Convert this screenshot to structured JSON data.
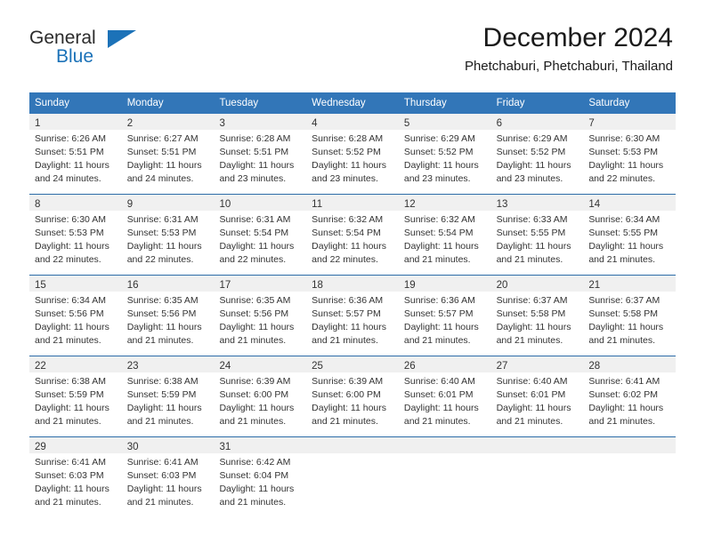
{
  "brand": {
    "name_part1": "General",
    "name_part2": "Blue",
    "triangle_color": "#1c72b8"
  },
  "header": {
    "title": "December 2024",
    "subtitle": "Phetchaburi, Phetchaburi, Thailand"
  },
  "colors": {
    "header_blue": "#3276b8",
    "row_separator": "#2c6ca8",
    "daynum_band": "#f0f0f0",
    "text": "#333333",
    "brand_blue": "#1c72b8"
  },
  "calendar": {
    "weekdays": [
      "Sunday",
      "Monday",
      "Tuesday",
      "Wednesday",
      "Thursday",
      "Friday",
      "Saturday"
    ],
    "weeks": [
      [
        {
          "day": "1",
          "sunrise": "Sunrise: 6:26 AM",
          "sunset": "Sunset: 5:51 PM",
          "daylight1": "Daylight: 11 hours",
          "daylight2": "and 24 minutes."
        },
        {
          "day": "2",
          "sunrise": "Sunrise: 6:27 AM",
          "sunset": "Sunset: 5:51 PM",
          "daylight1": "Daylight: 11 hours",
          "daylight2": "and 24 minutes."
        },
        {
          "day": "3",
          "sunrise": "Sunrise: 6:28 AM",
          "sunset": "Sunset: 5:51 PM",
          "daylight1": "Daylight: 11 hours",
          "daylight2": "and 23 minutes."
        },
        {
          "day": "4",
          "sunrise": "Sunrise: 6:28 AM",
          "sunset": "Sunset: 5:52 PM",
          "daylight1": "Daylight: 11 hours",
          "daylight2": "and 23 minutes."
        },
        {
          "day": "5",
          "sunrise": "Sunrise: 6:29 AM",
          "sunset": "Sunset: 5:52 PM",
          "daylight1": "Daylight: 11 hours",
          "daylight2": "and 23 minutes."
        },
        {
          "day": "6",
          "sunrise": "Sunrise: 6:29 AM",
          "sunset": "Sunset: 5:52 PM",
          "daylight1": "Daylight: 11 hours",
          "daylight2": "and 23 minutes."
        },
        {
          "day": "7",
          "sunrise": "Sunrise: 6:30 AM",
          "sunset": "Sunset: 5:53 PM",
          "daylight1": "Daylight: 11 hours",
          "daylight2": "and 22 minutes."
        }
      ],
      [
        {
          "day": "8",
          "sunrise": "Sunrise: 6:30 AM",
          "sunset": "Sunset: 5:53 PM",
          "daylight1": "Daylight: 11 hours",
          "daylight2": "and 22 minutes."
        },
        {
          "day": "9",
          "sunrise": "Sunrise: 6:31 AM",
          "sunset": "Sunset: 5:53 PM",
          "daylight1": "Daylight: 11 hours",
          "daylight2": "and 22 minutes."
        },
        {
          "day": "10",
          "sunrise": "Sunrise: 6:31 AM",
          "sunset": "Sunset: 5:54 PM",
          "daylight1": "Daylight: 11 hours",
          "daylight2": "and 22 minutes."
        },
        {
          "day": "11",
          "sunrise": "Sunrise: 6:32 AM",
          "sunset": "Sunset: 5:54 PM",
          "daylight1": "Daylight: 11 hours",
          "daylight2": "and 22 minutes."
        },
        {
          "day": "12",
          "sunrise": "Sunrise: 6:32 AM",
          "sunset": "Sunset: 5:54 PM",
          "daylight1": "Daylight: 11 hours",
          "daylight2": "and 21 minutes."
        },
        {
          "day": "13",
          "sunrise": "Sunrise: 6:33 AM",
          "sunset": "Sunset: 5:55 PM",
          "daylight1": "Daylight: 11 hours",
          "daylight2": "and 21 minutes."
        },
        {
          "day": "14",
          "sunrise": "Sunrise: 6:34 AM",
          "sunset": "Sunset: 5:55 PM",
          "daylight1": "Daylight: 11 hours",
          "daylight2": "and 21 minutes."
        }
      ],
      [
        {
          "day": "15",
          "sunrise": "Sunrise: 6:34 AM",
          "sunset": "Sunset: 5:56 PM",
          "daylight1": "Daylight: 11 hours",
          "daylight2": "and 21 minutes."
        },
        {
          "day": "16",
          "sunrise": "Sunrise: 6:35 AM",
          "sunset": "Sunset: 5:56 PM",
          "daylight1": "Daylight: 11 hours",
          "daylight2": "and 21 minutes."
        },
        {
          "day": "17",
          "sunrise": "Sunrise: 6:35 AM",
          "sunset": "Sunset: 5:56 PM",
          "daylight1": "Daylight: 11 hours",
          "daylight2": "and 21 minutes."
        },
        {
          "day": "18",
          "sunrise": "Sunrise: 6:36 AM",
          "sunset": "Sunset: 5:57 PM",
          "daylight1": "Daylight: 11 hours",
          "daylight2": "and 21 minutes."
        },
        {
          "day": "19",
          "sunrise": "Sunrise: 6:36 AM",
          "sunset": "Sunset: 5:57 PM",
          "daylight1": "Daylight: 11 hours",
          "daylight2": "and 21 minutes."
        },
        {
          "day": "20",
          "sunrise": "Sunrise: 6:37 AM",
          "sunset": "Sunset: 5:58 PM",
          "daylight1": "Daylight: 11 hours",
          "daylight2": "and 21 minutes."
        },
        {
          "day": "21",
          "sunrise": "Sunrise: 6:37 AM",
          "sunset": "Sunset: 5:58 PM",
          "daylight1": "Daylight: 11 hours",
          "daylight2": "and 21 minutes."
        }
      ],
      [
        {
          "day": "22",
          "sunrise": "Sunrise: 6:38 AM",
          "sunset": "Sunset: 5:59 PM",
          "daylight1": "Daylight: 11 hours",
          "daylight2": "and 21 minutes."
        },
        {
          "day": "23",
          "sunrise": "Sunrise: 6:38 AM",
          "sunset": "Sunset: 5:59 PM",
          "daylight1": "Daylight: 11 hours",
          "daylight2": "and 21 minutes."
        },
        {
          "day": "24",
          "sunrise": "Sunrise: 6:39 AM",
          "sunset": "Sunset: 6:00 PM",
          "daylight1": "Daylight: 11 hours",
          "daylight2": "and 21 minutes."
        },
        {
          "day": "25",
          "sunrise": "Sunrise: 6:39 AM",
          "sunset": "Sunset: 6:00 PM",
          "daylight1": "Daylight: 11 hours",
          "daylight2": "and 21 minutes."
        },
        {
          "day": "26",
          "sunrise": "Sunrise: 6:40 AM",
          "sunset": "Sunset: 6:01 PM",
          "daylight1": "Daylight: 11 hours",
          "daylight2": "and 21 minutes."
        },
        {
          "day": "27",
          "sunrise": "Sunrise: 6:40 AM",
          "sunset": "Sunset: 6:01 PM",
          "daylight1": "Daylight: 11 hours",
          "daylight2": "and 21 minutes."
        },
        {
          "day": "28",
          "sunrise": "Sunrise: 6:41 AM",
          "sunset": "Sunset: 6:02 PM",
          "daylight1": "Daylight: 11 hours",
          "daylight2": "and 21 minutes."
        }
      ],
      [
        {
          "day": "29",
          "sunrise": "Sunrise: 6:41 AM",
          "sunset": "Sunset: 6:03 PM",
          "daylight1": "Daylight: 11 hours",
          "daylight2": "and 21 minutes."
        },
        {
          "day": "30",
          "sunrise": "Sunrise: 6:41 AM",
          "sunset": "Sunset: 6:03 PM",
          "daylight1": "Daylight: 11 hours",
          "daylight2": "and 21 minutes."
        },
        {
          "day": "31",
          "sunrise": "Sunrise: 6:42 AM",
          "sunset": "Sunset: 6:04 PM",
          "daylight1": "Daylight: 11 hours",
          "daylight2": "and 21 minutes."
        },
        {
          "day": "",
          "sunrise": "",
          "sunset": "",
          "daylight1": "",
          "daylight2": ""
        },
        {
          "day": "",
          "sunrise": "",
          "sunset": "",
          "daylight1": "",
          "daylight2": ""
        },
        {
          "day": "",
          "sunrise": "",
          "sunset": "",
          "daylight1": "",
          "daylight2": ""
        },
        {
          "day": "",
          "sunrise": "",
          "sunset": "",
          "daylight1": "",
          "daylight2": ""
        }
      ]
    ]
  }
}
